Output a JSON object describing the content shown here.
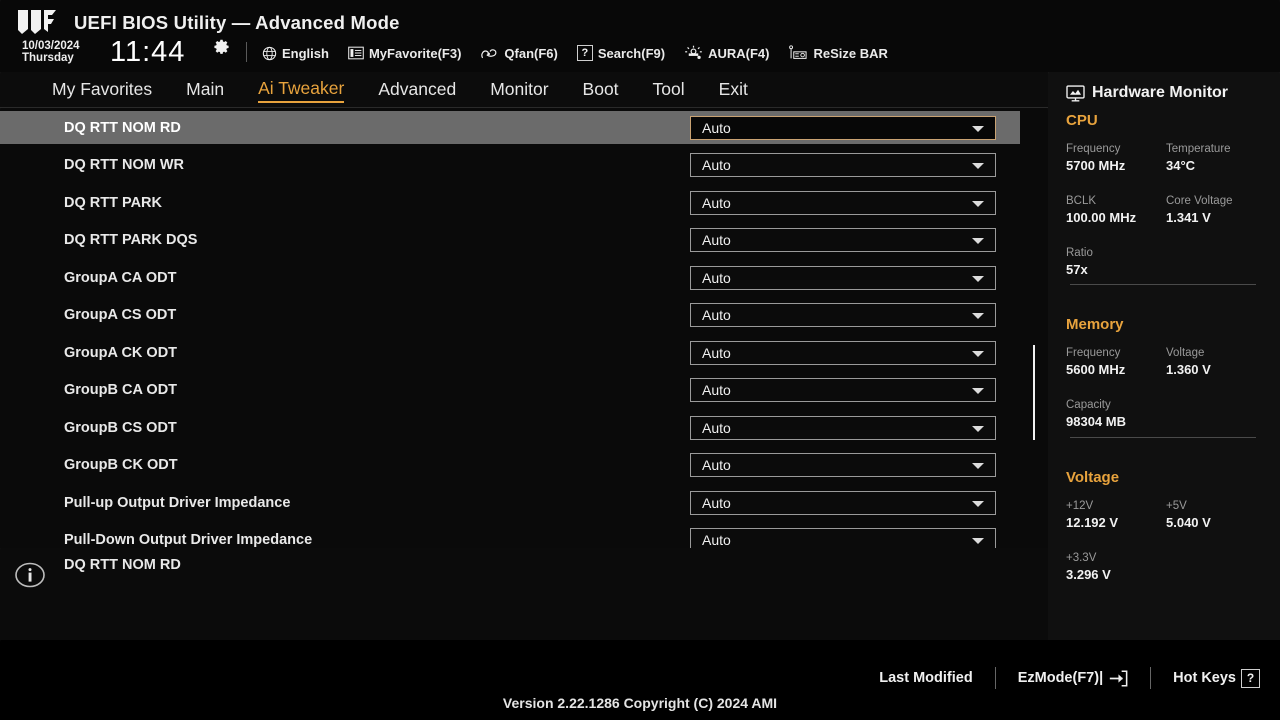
{
  "header": {
    "title": "UEFI BIOS Utility — Advanced Mode",
    "logo_icon": "tuf-gaming-logo",
    "date": "10/03/2024",
    "weekday": "Thursday",
    "time": "11:44",
    "gear_icon": "gear-icon",
    "items": [
      {
        "label": "English",
        "icon": "globe-icon"
      },
      {
        "label": "MyFavorite(F3)",
        "icon": "list-icon"
      },
      {
        "label": "Qfan(F6)",
        "icon": "fan-icon"
      },
      {
        "label": "Search(F9)",
        "icon": "question-box-icon"
      },
      {
        "label": "AURA(F4)",
        "icon": "aura-light-icon"
      },
      {
        "label": "ReSize BAR",
        "icon": "gpu-card-icon"
      }
    ]
  },
  "nav": {
    "tabs": [
      {
        "label": "My Favorites",
        "active": false
      },
      {
        "label": "Main",
        "active": false
      },
      {
        "label": "Ai Tweaker",
        "active": true
      },
      {
        "label": "Advanced",
        "active": false
      },
      {
        "label": "Monitor",
        "active": false
      },
      {
        "label": "Boot",
        "active": false
      },
      {
        "label": "Tool",
        "active": false
      },
      {
        "label": "Exit",
        "active": false
      }
    ],
    "active_color": "#e8a33d"
  },
  "settings": {
    "rows": [
      {
        "label": "DQ RTT NOM RD",
        "value": "Auto",
        "selected": true
      },
      {
        "label": "DQ RTT NOM WR",
        "value": "Auto",
        "selected": false
      },
      {
        "label": "DQ RTT PARK",
        "value": "Auto",
        "selected": false
      },
      {
        "label": "DQ RTT PARK DQS",
        "value": "Auto",
        "selected": false
      },
      {
        "label": "GroupA CA ODT",
        "value": "Auto",
        "selected": false
      },
      {
        "label": "GroupA CS ODT",
        "value": "Auto",
        "selected": false
      },
      {
        "label": "GroupA CK ODT",
        "value": "Auto",
        "selected": false
      },
      {
        "label": "GroupB CA ODT",
        "value": "Auto",
        "selected": false
      },
      {
        "label": "GroupB CS ODT",
        "value": "Auto",
        "selected": false
      },
      {
        "label": "GroupB CK ODT",
        "value": "Auto",
        "selected": false
      },
      {
        "label": "Pull-up Output Driver Impedance",
        "value": "Auto",
        "selected": false
      },
      {
        "label": "Pull-Down Output Driver Impedance",
        "value": "Auto",
        "selected": false
      }
    ],
    "selected_highlight": "#6b6b6b",
    "selected_border": "#c9a273"
  },
  "help": {
    "icon": "info-icon",
    "text": "DQ RTT NOM RD"
  },
  "hardware_monitor": {
    "title": "Hardware Monitor",
    "icon": "monitor-icon",
    "sections": [
      {
        "name": "CPU",
        "cells": [
          {
            "key": "Frequency",
            "value": "5700 MHz"
          },
          {
            "key": "Temperature",
            "value": "34°C"
          },
          {
            "key": "BCLK",
            "value": "100.00 MHz"
          },
          {
            "key": "Core Voltage",
            "value": "1.341 V"
          },
          {
            "key": "Ratio",
            "value": "57x"
          }
        ]
      },
      {
        "name": "Memory",
        "cells": [
          {
            "key": "Frequency",
            "value": "5600 MHz"
          },
          {
            "key": "Voltage",
            "value": "1.360 V"
          },
          {
            "key": "Capacity",
            "value": "98304 MB"
          }
        ]
      },
      {
        "name": "Voltage",
        "cells": [
          {
            "key": "+12V",
            "value": "12.192 V"
          },
          {
            "key": "+5V",
            "value": "5.040 V"
          },
          {
            "key": "+3.3V",
            "value": "3.296 V"
          }
        ]
      }
    ],
    "section_color": "#e8a33d"
  },
  "footer": {
    "last_modified": "Last Modified",
    "ezmode": "EzMode(F7)|",
    "ezmode_icon": "arrow-into-bracket-icon",
    "hotkeys": "Hot Keys",
    "hotkeys_icon": "question-box-icon",
    "version": "Version 2.22.1286 Copyright (C) 2024 AMI"
  }
}
